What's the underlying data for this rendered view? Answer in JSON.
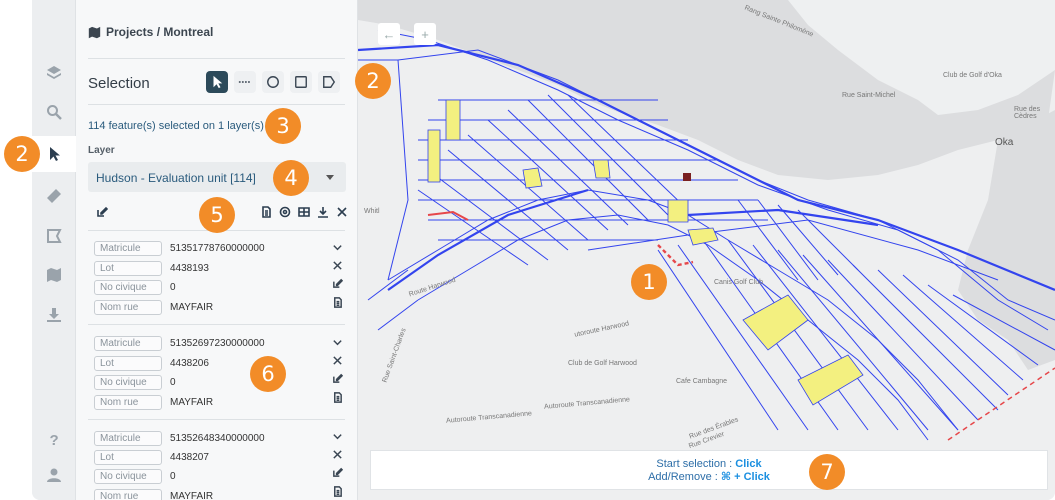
{
  "panel": {
    "breadcrumb": "Projects / Montreal",
    "selection_title": "Selection",
    "selected_count": "114 feature(s) selected on 1 layer(s)",
    "layer_label": "Layer",
    "layer_value": "Hudson - Evaluation unit [114]"
  },
  "features": [
    {
      "fields": [
        {
          "key": "Matricule",
          "value": "51351778760000000"
        },
        {
          "key": "Lot",
          "value": "4438193"
        },
        {
          "key": "No civique",
          "value": "0"
        },
        {
          "key": "Nom rue",
          "value": "MAYFAIR"
        }
      ]
    },
    {
      "fields": [
        {
          "key": "Matricule",
          "value": "51352697230000000"
        },
        {
          "key": "Lot",
          "value": "4438206"
        },
        {
          "key": "No civique",
          "value": "0"
        },
        {
          "key": "Nom rue",
          "value": "MAYFAIR"
        }
      ]
    },
    {
      "fields": [
        {
          "key": "Matricule",
          "value": "51352648340000000"
        },
        {
          "key": "Lot",
          "value": "4438207"
        },
        {
          "key": "No civique",
          "value": "0"
        },
        {
          "key": "Nom rue",
          "value": "MAYFAIR"
        }
      ]
    }
  ],
  "hint": {
    "start_label": "Start selection : ",
    "start_key": "Click",
    "add_label": "Add/Remove : ",
    "add_key": "⌘ + Click"
  },
  "map": {
    "back_glyph": "←",
    "zoom_glyph": "+",
    "labels": {
      "rang_ste_philomene": "Rang Sainte Philomène",
      "club_golf_oka": "Club de Golf d'Oka",
      "rue_saint_michel": "Rue Saint-Michel",
      "rue_des_cedres": "Rue des Cèdres",
      "oka": "Oka",
      "route_harwood": "Route Harwood",
      "rue_saint_charles": "Rue Saint-Charles",
      "autoroute_harwood": "utoroute Harwood",
      "club_golf_harwood": "Club de Golf Harwood",
      "cafe_cambagne": "Cafe Cambagne",
      "autoroute_transcanadienne_1": "Autoroute Transcanadienne",
      "autoroute_transcanadienne_2": "Autoroute Transcanadienne",
      "rue_des_erables": "Rue des Érables",
      "rue_crevier": "Rue Crevier",
      "canis_golf_club": "Canis Golf Club",
      "whitlock": "Whitl"
    }
  },
  "badges": {
    "b1": "1",
    "b2_map": "2",
    "b2_rail": "2",
    "b3": "3",
    "b4": "4",
    "b5": "5",
    "b6": "6",
    "b7": "7"
  },
  "colors": {
    "accent": "#f28c28",
    "road_blue": "#3344ee",
    "parcel_yellow": "#f3f080",
    "water": "#dcdddf",
    "link": "#1b8fe0"
  }
}
